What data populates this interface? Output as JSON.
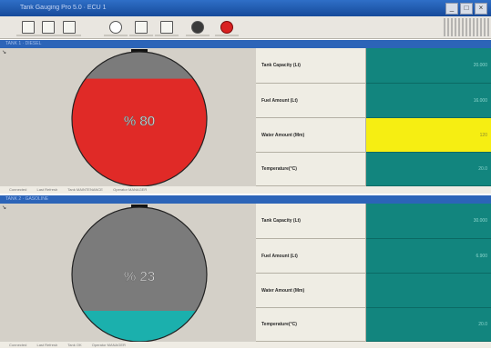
{
  "window": {
    "title": "Tank Gauging Pro 5.0  ·  ECU 1",
    "controls": [
      "_",
      "□",
      "×"
    ]
  },
  "toolbar": {
    "buttons": [
      {
        "name": "open-folder-icon"
      },
      {
        "name": "new-page-icon"
      },
      {
        "name": "ruler-icon"
      },
      {
        "name": "search-icon"
      },
      {
        "name": "expand-icon"
      },
      {
        "name": "document-icon"
      },
      {
        "name": "gear-icon"
      },
      {
        "name": "stop-icon"
      }
    ]
  },
  "tanks": [
    {
      "header": "TANK 1 · DIESEL",
      "percent_label": "% 80",
      "fill_percent": 80,
      "fill_color": "#e02a27",
      "empty_color": "#7b7b7b",
      "rows": [
        {
          "label": "Tank Capacity (Lt)",
          "value": "20.000",
          "highlight": false
        },
        {
          "label": "Fuel  Amount (Lt)",
          "value": "16.000",
          "highlight": false
        },
        {
          "label": "Water Amount (Mm)",
          "value": "120",
          "highlight": true
        },
        {
          "label": "Temperature(°C)",
          "value": "20.0",
          "highlight": false
        }
      ],
      "status": [
        "Connected",
        "Last Refresh",
        "Tank MAINTENANCE",
        "Operator MANAGER"
      ]
    },
    {
      "header": "TANK 2 · GASOLINE",
      "percent_label": "% 23",
      "fill_percent": 23,
      "fill_color": "#1bb0ad",
      "empty_color": "#7b7b7b",
      "rows": [
        {
          "label": "Tank Capacity (Lt)",
          "value": "30.000",
          "highlight": false
        },
        {
          "label": "Fuel  Amount (Lt)",
          "value": "6.900",
          "highlight": false
        },
        {
          "label": "Water Amount (Mm)",
          "value": "",
          "highlight": false
        },
        {
          "label": "Temperature(°C)",
          "value": "20.0",
          "highlight": false
        }
      ],
      "status": [
        "Connected",
        "Last Refresh",
        "Tank OK",
        "Operator MANAGER"
      ]
    }
  ]
}
